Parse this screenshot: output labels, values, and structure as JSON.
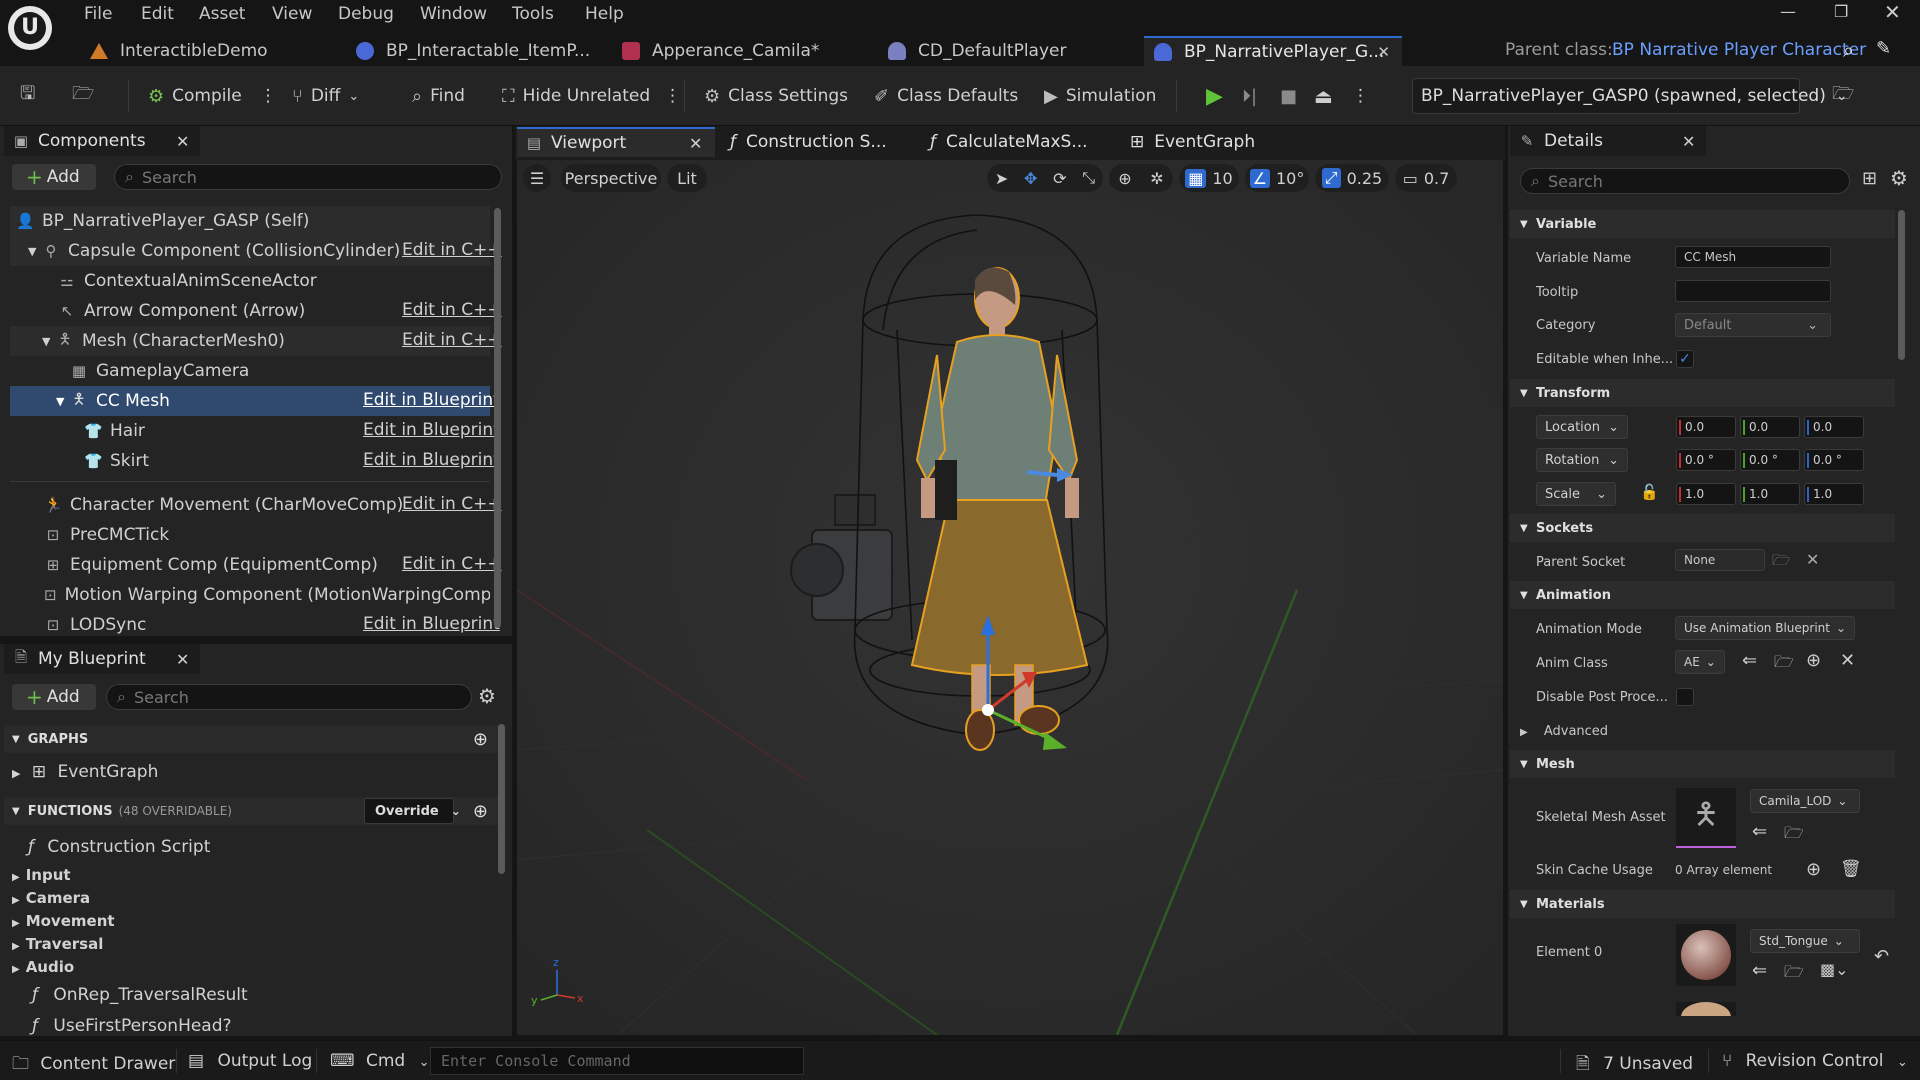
{
  "menu": [
    "File",
    "Edit",
    "Asset",
    "View",
    "Debug",
    "Window",
    "Tools",
    "Help"
  ],
  "doc_tabs": [
    {
      "label": "InteractibleDemo",
      "color": "#d07a2a"
    },
    {
      "label": "BP_Interactable_ItemP...",
      "color": "#4a69d6"
    },
    {
      "label": "Apperance_Camila*",
      "color": "#b03050"
    },
    {
      "label": "CD_DefaultPlayer",
      "color": "#7a7fc0"
    },
    {
      "label": "BP_NarrativePlayer_G...",
      "color": "#4a69d6"
    }
  ],
  "parent_class": {
    "label": "Parent class:",
    "value": "BP Narrative Player Character"
  },
  "toolbar": {
    "compile": "Compile",
    "diff": "Diff",
    "find": "Find",
    "hide_unrelated": "Hide Unrelated",
    "class_settings": "Class Settings",
    "class_defaults": "Class Defaults",
    "simulation": "Simulation",
    "debug_object": "BP_NarrativePlayer_GASP0 (spawned, selected)"
  },
  "components_panel": {
    "title": "Components",
    "add": "Add",
    "search_placeholder": "Search",
    "items": [
      {
        "label": "BP_NarrativePlayer_GASP (Self)",
        "edit": ""
      },
      {
        "label": "Capsule Component (CollisionCylinder)",
        "edit": "Edit in C++"
      },
      {
        "label": "ContextualAnimSceneActor",
        "edit": ""
      },
      {
        "label": "Arrow Component (Arrow)",
        "edit": "Edit in C++"
      },
      {
        "label": "Mesh (CharacterMesh0)",
        "edit": "Edit in C++"
      },
      {
        "label": "GameplayCamera",
        "edit": ""
      },
      {
        "label": "CC Mesh",
        "edit": "Edit in Blueprint"
      },
      {
        "label": "Hair",
        "edit": "Edit in Blueprint"
      },
      {
        "label": "Skirt",
        "edit": "Edit in Blueprint"
      },
      {
        "label": "Character Movement (CharMoveComp)",
        "edit": "Edit in C++"
      },
      {
        "label": "PreCMCTick",
        "edit": ""
      },
      {
        "label": "Equipment Comp (EquipmentComp)",
        "edit": "Edit in C++"
      },
      {
        "label": "Motion Warping Component (MotionWarpingComponent)",
        "edit": ""
      },
      {
        "label": "LODSync",
        "edit": "Edit in Blueprint"
      }
    ]
  },
  "my_blueprint": {
    "title": "My Blueprint",
    "add": "Add",
    "search_placeholder": "Search",
    "graphs_label": "GRAPHS",
    "event_graph": "EventGraph",
    "functions_label": "FUNCTIONS",
    "functions_count": "(48 OVERRIDABLE)",
    "override": "Override",
    "construction_script": "Construction Script",
    "categories": [
      "Input",
      "Camera",
      "Movement",
      "Traversal",
      "Audio"
    ],
    "functions": [
      "OnRep_TraversalResult",
      "UseFirstPersonHead?"
    ]
  },
  "editor_tabs": [
    "Viewport",
    "Construction S...",
    "CalculateMaxS...",
    "EventGraph"
  ],
  "viewport": {
    "perspective": "Perspective",
    "lit": "Lit",
    "grid_snap": "10",
    "rot_snap": "10°",
    "scale_snap": "0.25",
    "cam_speed": "0.7"
  },
  "details": {
    "title": "Details",
    "search_placeholder": "Search",
    "variable": {
      "section": "Variable",
      "name_label": "Variable Name",
      "name_value": "CC Mesh",
      "tooltip_label": "Tooltip",
      "tooltip_value": "",
      "category_label": "Category",
      "category_value": "Default",
      "editable_label": "Editable when Inhe..."
    },
    "transform": {
      "section": "Transform",
      "location": "Location",
      "rotation": "Rotation",
      "scale": "Scale",
      "loc": [
        "0.0",
        "0.0",
        "0.0"
      ],
      "rot": [
        "0.0 °",
        "0.0 °",
        "0.0 °"
      ],
      "scl": [
        "1.0",
        "1.0",
        "1.0"
      ]
    },
    "sockets": {
      "section": "Sockets",
      "parent_label": "Parent Socket",
      "parent_value": "None"
    },
    "animation": {
      "section": "Animation",
      "mode_label": "Animation Mode",
      "mode_value": "Use Animation Blueprint",
      "class_label": "Anim Class",
      "class_value": "AE",
      "disable_label": "Disable Post Proce...",
      "advanced": "Advanced"
    },
    "mesh": {
      "section": "Mesh",
      "asset_label": "Skeletal Mesh Asset",
      "asset_value": "Camila_LOD",
      "skin_label": "Skin Cache Usage",
      "skin_value": "0 Array element"
    },
    "materials": {
      "section": "Materials",
      "element_label": "Element 0",
      "element_value": "Std_Tongue"
    }
  },
  "status": {
    "content_drawer": "Content Drawer",
    "output_log": "Output Log",
    "cmd": "Cmd",
    "console_placeholder": "Enter Console Command",
    "unsaved": "7 Unsaved",
    "revision": "Revision Control"
  }
}
